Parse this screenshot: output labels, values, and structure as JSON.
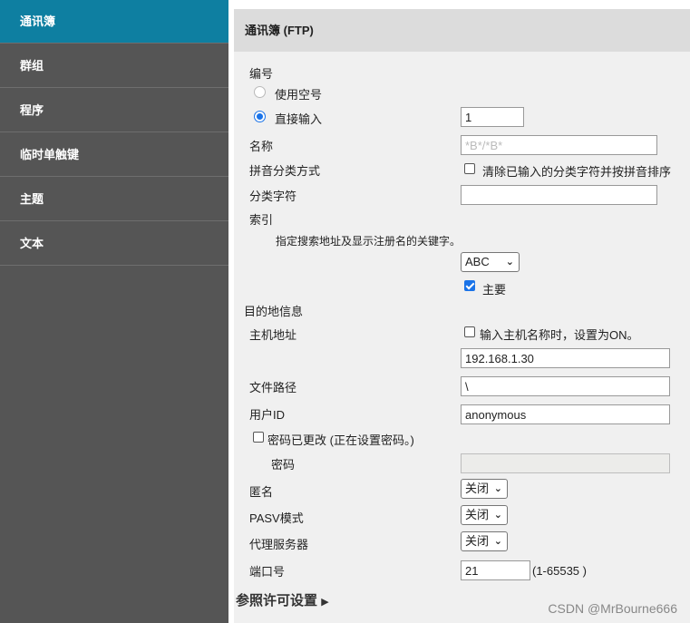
{
  "sidebar": {
    "items": [
      {
        "label": "通讯簿"
      },
      {
        "label": "群组"
      },
      {
        "label": "程序"
      },
      {
        "label": "临时单触键"
      },
      {
        "label": "主题"
      },
      {
        "label": "文本"
      }
    ]
  },
  "panel": {
    "title": "通讯簿 (FTP)",
    "number": {
      "label": "编号",
      "radio_empty": "使用空号",
      "radio_direct": "直接输入",
      "value": "1"
    },
    "name": {
      "label": "名称",
      "value": "*B*/*B*"
    },
    "pinyin": {
      "label": "拼音分类方式",
      "checkbox": "清除已输入的分类字符并按拼音排序"
    },
    "category": {
      "label": "分类字符",
      "value": ""
    },
    "index": {
      "label": "索引",
      "hint": "指定搜索地址及显示注册名的关键字。",
      "select_value": "ABC",
      "main_checkbox": "主要"
    },
    "destination": {
      "label": "目的地信息",
      "host": {
        "label": "主机地址",
        "checkbox": "输入主机名称时，设置为ON。",
        "value": "192.168.1.30"
      },
      "path": {
        "label": "文件路径",
        "value": "\\"
      },
      "user": {
        "label": "用户ID",
        "value": "anonymous"
      },
      "pw_changed": {
        "checkbox": "密码已更改 (正在设置密码。)"
      },
      "password": {
        "label": "密码",
        "value": ""
      },
      "anonymous": {
        "label": "匿名",
        "value": "关闭"
      },
      "pasv": {
        "label": "PASV模式",
        "value": "关闭"
      },
      "proxy": {
        "label": "代理服务器",
        "value": "关闭"
      },
      "port": {
        "label": "端口号",
        "value": "21",
        "range": "(1-65535 )"
      }
    },
    "ref_permission": "参照许可设置"
  },
  "watermark": "CSDN @MrBourne666"
}
